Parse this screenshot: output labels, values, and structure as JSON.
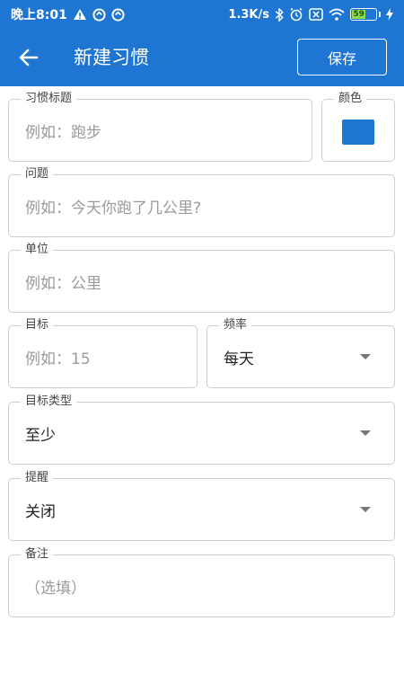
{
  "status_bar": {
    "time": "晚上8:01",
    "network_speed": "1.3K/s",
    "battery_level": "59",
    "icons": [
      "warning-icon",
      "sync-icon",
      "sync-icon",
      "bluetooth-icon",
      "alarm-icon",
      "sim-off-icon",
      "wifi-icon",
      "battery-icon",
      "charging-icon"
    ]
  },
  "app_bar": {
    "title": "新建习惯",
    "save_label": "保存"
  },
  "form": {
    "habit_title": {
      "label": "习惯标题",
      "placeholder": "例如：跑步"
    },
    "color": {
      "label": "颜色",
      "value": "#1f76d2"
    },
    "question": {
      "label": "问题",
      "placeholder": "例如：今天你跑了几公里?"
    },
    "unit": {
      "label": "单位",
      "placeholder": "例如：公里"
    },
    "target": {
      "label": "目标",
      "placeholder": "例如：15"
    },
    "frequency": {
      "label": "频率",
      "value": "每天"
    },
    "target_type": {
      "label": "目标类型",
      "value": "至少"
    },
    "reminder": {
      "label": "提醒",
      "value": "关闭"
    },
    "notes": {
      "label": "备注",
      "placeholder": "（选填）"
    }
  },
  "colors": {
    "primary": "#1f76d2",
    "border": "#cfcfcf",
    "placeholder": "#9a9a9a"
  }
}
